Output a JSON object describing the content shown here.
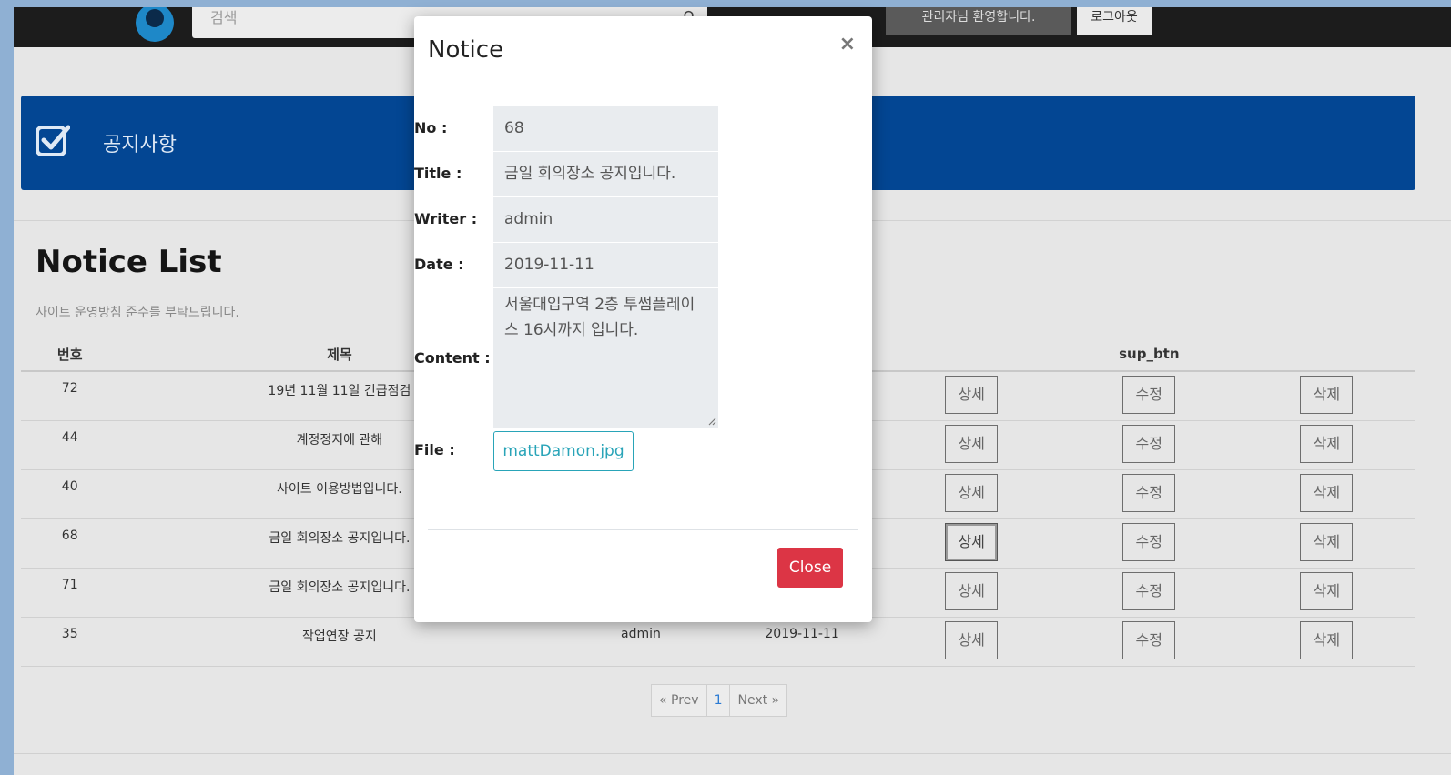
{
  "header": {
    "search_placeholder": "검색",
    "welcome_text": "관리자님 환영합니다.",
    "logout_label": "로그아웃"
  },
  "banner": {
    "title": "공지사항"
  },
  "notice_list": {
    "title": "Notice List",
    "subtitle": "사이트 운영방침 준수를 부탁드립니다.",
    "columns": {
      "no": "번호",
      "title": "제목",
      "sup_btn": "sup_btn"
    },
    "rows": [
      {
        "no": "72",
        "title": "19년 11월 11일 긴급점검",
        "writer": "",
        "date": ""
      },
      {
        "no": "44",
        "title": "계정정지에 관해",
        "writer": "",
        "date": ""
      },
      {
        "no": "40",
        "title": "사이트 이용방법입니다.",
        "writer": "",
        "date": ""
      },
      {
        "no": "68",
        "title": "금일 회의장소 공지입니다.",
        "writer": "",
        "date": ""
      },
      {
        "no": "71",
        "title": "금일 회의장소 공지입니다.",
        "writer": "",
        "date": ""
      },
      {
        "no": "35",
        "title": "작업연장 공지",
        "writer": "admin",
        "date": "2019-11-11"
      }
    ],
    "buttons": {
      "detail": "상세",
      "edit": "수정",
      "delete": "삭제"
    }
  },
  "pagination": {
    "prev": "« Prev",
    "current": "1",
    "next": "Next »"
  },
  "modal": {
    "title": "Notice",
    "close_x": "×",
    "labels": {
      "no": "No :",
      "title": "Title :",
      "writer": "Writer :",
      "date": "Date :",
      "content": "Content :",
      "file": "File :"
    },
    "values": {
      "no": "68",
      "title": "금일 회의장소 공지입니다.",
      "writer": "admin",
      "date": "2019-11-11",
      "content_line1": "서울대입구역 2층 투썸플레이",
      "content_line2": "스 16시까지 입니다."
    },
    "file_name": "mattDamon.jpg",
    "close_label": "Close"
  },
  "colors": {
    "banner": "#034693",
    "close_button": "#dc3545",
    "file_button": "#29a4b8",
    "navbar": "#1c1c1c"
  }
}
